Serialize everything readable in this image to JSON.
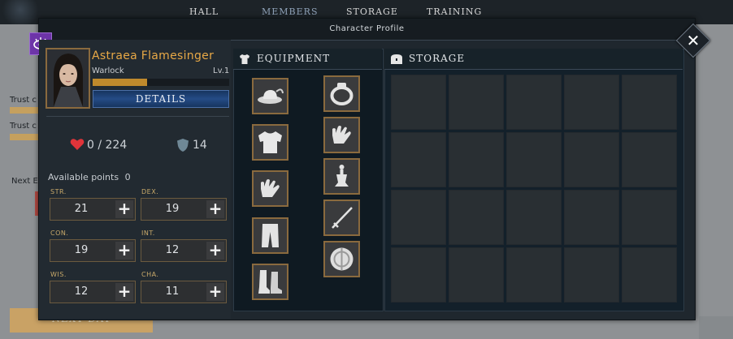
{
  "nav": {
    "tabs": [
      "HALL",
      "MEMBERS",
      "STORAGE",
      "TRAINING"
    ],
    "active": "MEMBERS"
  },
  "background": {
    "trust_label_1": "Trust c",
    "trust_label_2": "Trust c",
    "next_label": "Next E",
    "next_day_button": "NEXT DAY"
  },
  "modal": {
    "title": "Character Profile",
    "close_label": "✕"
  },
  "character": {
    "name": "Astraea Flamesinger",
    "class": "Warlock",
    "level": "Lv.1",
    "xp_fraction": 0.4,
    "details_label": "DETAILS",
    "hp": "0 / 224",
    "defense": "14",
    "available_points_label": "Available points",
    "available_points": "0"
  },
  "stats": [
    {
      "label": "STR.",
      "value": "21"
    },
    {
      "label": "DEX.",
      "value": "19"
    },
    {
      "label": "CON.",
      "value": "19"
    },
    {
      "label": "INT.",
      "value": "12"
    },
    {
      "label": "WIS.",
      "value": "12"
    },
    {
      "label": "CHA.",
      "value": "11"
    }
  ],
  "equipment": {
    "title": "EQUIPMENT",
    "left_slots": [
      "hat-icon",
      "shirt-icon",
      "gloves-icon",
      "pants-icon",
      "boots-icon"
    ],
    "right_slots": [
      "ring-icon",
      "gloves-icon",
      "amulet-icon",
      "sword-icon",
      "shield-icon"
    ]
  },
  "storage": {
    "title": "STORAGE",
    "rows": 4,
    "cols": 5
  },
  "colors": {
    "accent_gold": "#e7a846",
    "frame_bronze": "#8a6a3e",
    "details_blue": "#254b86",
    "hp_red": "#e0343a"
  }
}
